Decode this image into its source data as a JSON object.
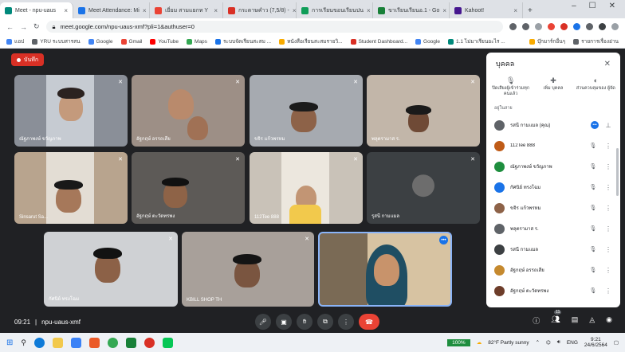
{
  "browser": {
    "tabs": [
      {
        "label": "Meet - npu-uaus",
        "color": "#00897b",
        "active": true
      },
      {
        "label": "Meet Attendance: Mi",
        "color": "#1a73e8"
      },
      {
        "label": "เยี่ยม สามแยกท Y",
        "color": "#ea4335"
      },
      {
        "label": "กระดาษคำว (7,5/8) -",
        "color": "#d93025"
      },
      {
        "label": "การเรียนขอนเรียนปน",
        "color": "#0f9d58"
      },
      {
        "label": "ขาเรียนเรียนอ.1 - Go",
        "color": "#188038"
      },
      {
        "label": "Kahoot!",
        "color": "#46178f"
      }
    ],
    "new_tab": "+",
    "url": "meet.google.com/npu-uaus-xmf?pli=1&authuser=0",
    "bookmarks": [
      {
        "label": "แอป",
        "color": "#4285f4"
      },
      {
        "label": "YRU ระบบสารสน",
        "color": "#5f6368"
      },
      {
        "label": "Google",
        "color": "#4285f4"
      },
      {
        "label": "Gmail",
        "color": "#ea4335"
      },
      {
        "label": "YouTube",
        "color": "#ff0000"
      },
      {
        "label": "Maps",
        "color": "#34a853"
      },
      {
        "label": "ระบบจัดเรียนสะสม ...",
        "color": "#1a73e8"
      },
      {
        "label": "หนังสือเรียนสะสมรายวิ...",
        "color": "#f9ab00"
      },
      {
        "label": "Student Dashboard...",
        "color": "#d93025"
      },
      {
        "label": "Google",
        "color": "#4285f4"
      },
      {
        "label": "1.1 ไม่มาเรียนอะไร ...",
        "color": "#00897b"
      },
      {
        "label": "บุ๊กมาร์กอื่นๆ",
        "color": "#f9ab00"
      },
      {
        "label": "รายการเรื่องอ่าน",
        "color": "#5f6368"
      }
    ]
  },
  "meet": {
    "record_label": "บันทึก",
    "time": "09:21",
    "meeting_code": "npu-uaus-xmf",
    "tiles": [
      {
        "name": "ณัฐภาพงษ์ ขวัญภาพ",
        "bg": "#8a8f98",
        "skin": "#c49a7c"
      },
      {
        "name": "อัฐกฤษ์ อรรถเสีย",
        "bg": "#9d8f86",
        "skin": "#b98a6c"
      },
      {
        "name": "ขจิร แก้วพรหม",
        "bg": "#a6aab0",
        "skin": "#8d6248"
      },
      {
        "name": "พลุตรามาส ร.",
        "bg": "#c2b6a9",
        "skin": "#6f4a36"
      },
      {
        "name": "Sinsarut Sa...",
        "bg": "#b8a48e",
        "skin": "#a6785a"
      },
      {
        "name": "อัฐกฤษ์ ตะวัดทรพง",
        "bg": "#5d5a57",
        "skin": "#8e6347"
      },
      {
        "name": "112Tee 888",
        "bg": "#c9c2b8",
        "skin": "#c29574"
      },
      {
        "name": "รุสนี กามแมล",
        "bg": "#3c4043",
        "skin": "#6d6d6d"
      },
      {
        "name": "กัศนิย์ ทรงโฉม",
        "bg": "#cfd1d4",
        "skin": "#8c6147"
      },
      {
        "name": "KBILL SHOP TH",
        "bg": "#a8a09a",
        "skin": "#7a5540"
      },
      {
        "name": "",
        "bg": "#d7c3a2",
        "skin": "#c8936b"
      }
    ],
    "controls": [
      "mic",
      "cam",
      "hand",
      "present",
      "more",
      "end"
    ],
    "right_controls": {
      "info": "ⓘ",
      "people_count": "11",
      "chat": "▤",
      "activities": "◬",
      "host": "◉"
    }
  },
  "people_panel": {
    "title": "บุคคล",
    "actions": [
      {
        "icon": "mic-off",
        "label": "ปิดเสียงผู้เข้าร่วมทุก คนแล้ว"
      },
      {
        "icon": "add-person",
        "label": "เพิ่ม บุคคล"
      },
      {
        "icon": "toggle",
        "label": "ส่วนควบคุมของ ผู้จัด"
      }
    ],
    "section_label": "อยู่ในสาย",
    "people": [
      {
        "name": "รสนี กามแมล (คุณ)",
        "color": "#5f6368"
      },
      {
        "name": "112Tee 888",
        "color": "#bf5b17"
      },
      {
        "name": "ณัฐภาพงษ์ ขวัญภาพ",
        "color": "#1e8e3e"
      },
      {
        "name": "กัศนิย์ ทรงโฉม",
        "color": "#1a73e8"
      },
      {
        "name": "ขจิร แก้วพรหม",
        "color": "#8d6248"
      },
      {
        "name": "พลุตรามาส ร.",
        "color": "#5f6368"
      },
      {
        "name": "รสนี กามแมล",
        "color": "#3c4043"
      },
      {
        "name": "อัฐกฤษ์ อรรถเสีย",
        "color": "#c5892e"
      },
      {
        "name": "อัฐกฤษ์ ตะวัดทรพง",
        "color": "#6d3d2a"
      }
    ]
  },
  "taskbar": {
    "zoom": "100%",
    "weather": "82°F Partly sunny",
    "lang": "ENG",
    "clock_time": "9:21",
    "clock_date": "24/6/2564"
  }
}
